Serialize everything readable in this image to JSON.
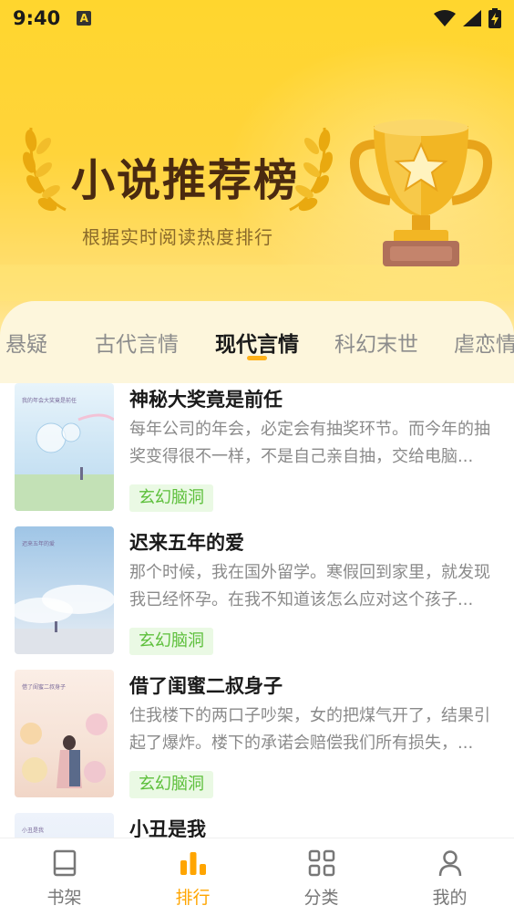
{
  "status_bar": {
    "time": "9:40",
    "notification_icon": "A",
    "icons": [
      "wifi-icon",
      "signal-icon",
      "battery-charging-icon"
    ]
  },
  "banner": {
    "title": "小说推荐榜",
    "subtitle": "根据实时阅读热度排行"
  },
  "tabs": [
    {
      "label": "悬疑",
      "active": false
    },
    {
      "label": "古代言情",
      "active": false
    },
    {
      "label": "现代言情",
      "active": true
    },
    {
      "label": "科幻末世",
      "active": false
    },
    {
      "label": "虐恋情",
      "active": false
    }
  ],
  "books": [
    {
      "title": "神秘大奖竟是前任",
      "description": "每年公司的年会，必定会有抽奖环节。而今年的抽奖变得很不一样，不是自己亲自抽，交给电脑...",
      "tag": "玄幻脑洞",
      "cover_text": "我的年会大奖竟是前任"
    },
    {
      "title": "迟来五年的爱",
      "description": "那个时候，我在国外留学。寒假回到家里，就发现我已经怀孕。在我不知道该怎么应对这个孩子...",
      "tag": "玄幻脑洞",
      "cover_text": "迟来五年的爱"
    },
    {
      "title": "借了闺蜜二叔身子",
      "description": "住我楼下的两口子吵架，女的把煤气开了，结果引起了爆炸。楼下的承诺会赔偿我们所有损失，...",
      "tag": "玄幻脑洞",
      "cover_text": "借了闺蜜二叔身子"
    },
    {
      "title": "小丑是我",
      "description": "",
      "tag": "",
      "cover_text": "小丑是我"
    }
  ],
  "bottom_nav": [
    {
      "label": "书架",
      "icon": "book-icon",
      "active": false
    },
    {
      "label": "排行",
      "icon": "bar-chart-icon",
      "active": true
    },
    {
      "label": "分类",
      "icon": "grid-icon",
      "active": false
    },
    {
      "label": "我的",
      "icon": "person-icon",
      "active": false
    }
  ],
  "colors": {
    "accent": "#ffa500",
    "banner_yellow": "#ffd62e",
    "tag_green": "#5cbf3a",
    "tag_bg": "#eaf9e4",
    "title_brown": "#4a2a10"
  }
}
